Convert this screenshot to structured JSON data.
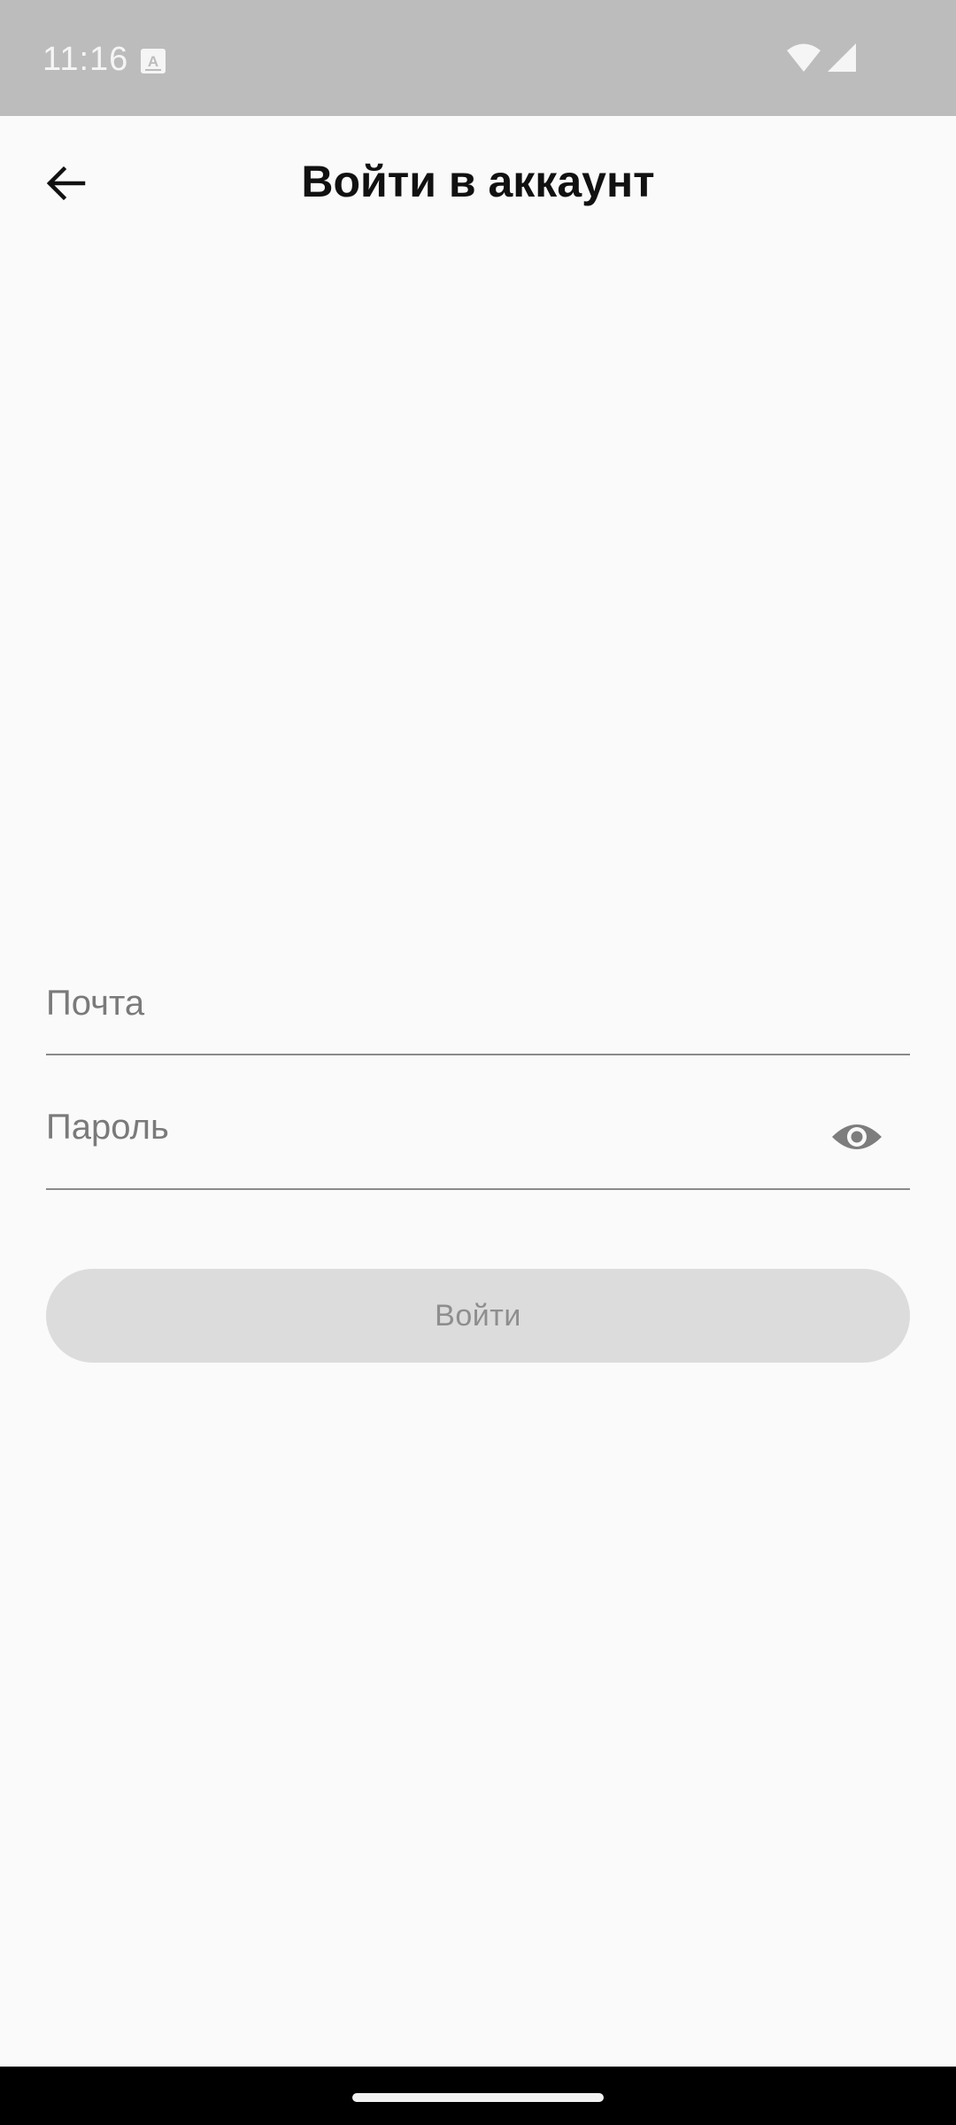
{
  "status_bar": {
    "time": "11:16",
    "notification_icon": "text-a-icon",
    "wifi_icon": "wifi-icon",
    "signal_icon": "cellular-signal-icon"
  },
  "header": {
    "title": "Войти в аккаунт",
    "back_icon": "arrow-back-icon"
  },
  "form": {
    "email": {
      "placeholder": "Почта",
      "value": ""
    },
    "password": {
      "placeholder": "Пароль",
      "value": "",
      "toggle_icon": "eye-icon"
    },
    "submit_label": "Войти",
    "submit_enabled": false
  },
  "colors": {
    "status_bar_bg": "#bcbcbc",
    "page_bg": "#fafafa",
    "button_disabled_bg": "#dcdcdc",
    "button_disabled_text": "#8e8e8e",
    "field_underline": "#8a8a8a",
    "nav_bar_bg": "#000000"
  }
}
